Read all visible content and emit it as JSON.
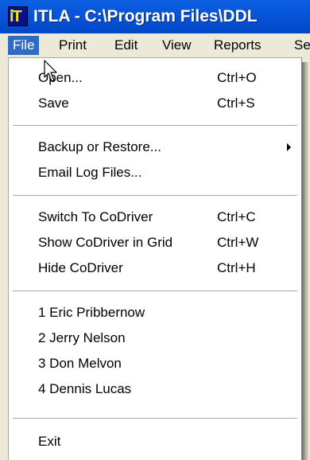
{
  "window": {
    "title": "ITLA - C:\\Program Files\\DDL"
  },
  "menubar": {
    "items": [
      {
        "label": "File",
        "active": true
      },
      {
        "label": "Print"
      },
      {
        "label": "Edit"
      },
      {
        "label": "View"
      },
      {
        "label": "Reports"
      },
      {
        "label": "Se"
      }
    ]
  },
  "file_menu": {
    "items": [
      {
        "label": "Open...",
        "shortcut": "Ctrl+O"
      },
      {
        "label": "Save",
        "shortcut": "Ctrl+S"
      },
      {
        "label": "Backup or Restore...",
        "submenu": true
      },
      {
        "label": "Email Log Files..."
      },
      {
        "label": "Switch To CoDriver",
        "shortcut": "Ctrl+C"
      },
      {
        "label": "Show CoDriver in Grid",
        "shortcut": "Ctrl+W"
      },
      {
        "label": "Hide CoDriver",
        "shortcut": "Ctrl+H"
      },
      {
        "label": "1 Eric Pribbernow"
      },
      {
        "label": "2 Jerry Nelson"
      },
      {
        "label": "3 Don Melvon"
      },
      {
        "label": "4 Dennis Lucas"
      },
      {
        "label": "Exit"
      }
    ]
  },
  "icons": {
    "app": "itla-app-icon",
    "cursor": "mouse-pointer-icon",
    "submenu": "submenu-arrow-icon"
  },
  "colors": {
    "titlebar": "#0854d8",
    "menu_highlight": "#316ac5",
    "menu_bg": "#ece9d8"
  }
}
